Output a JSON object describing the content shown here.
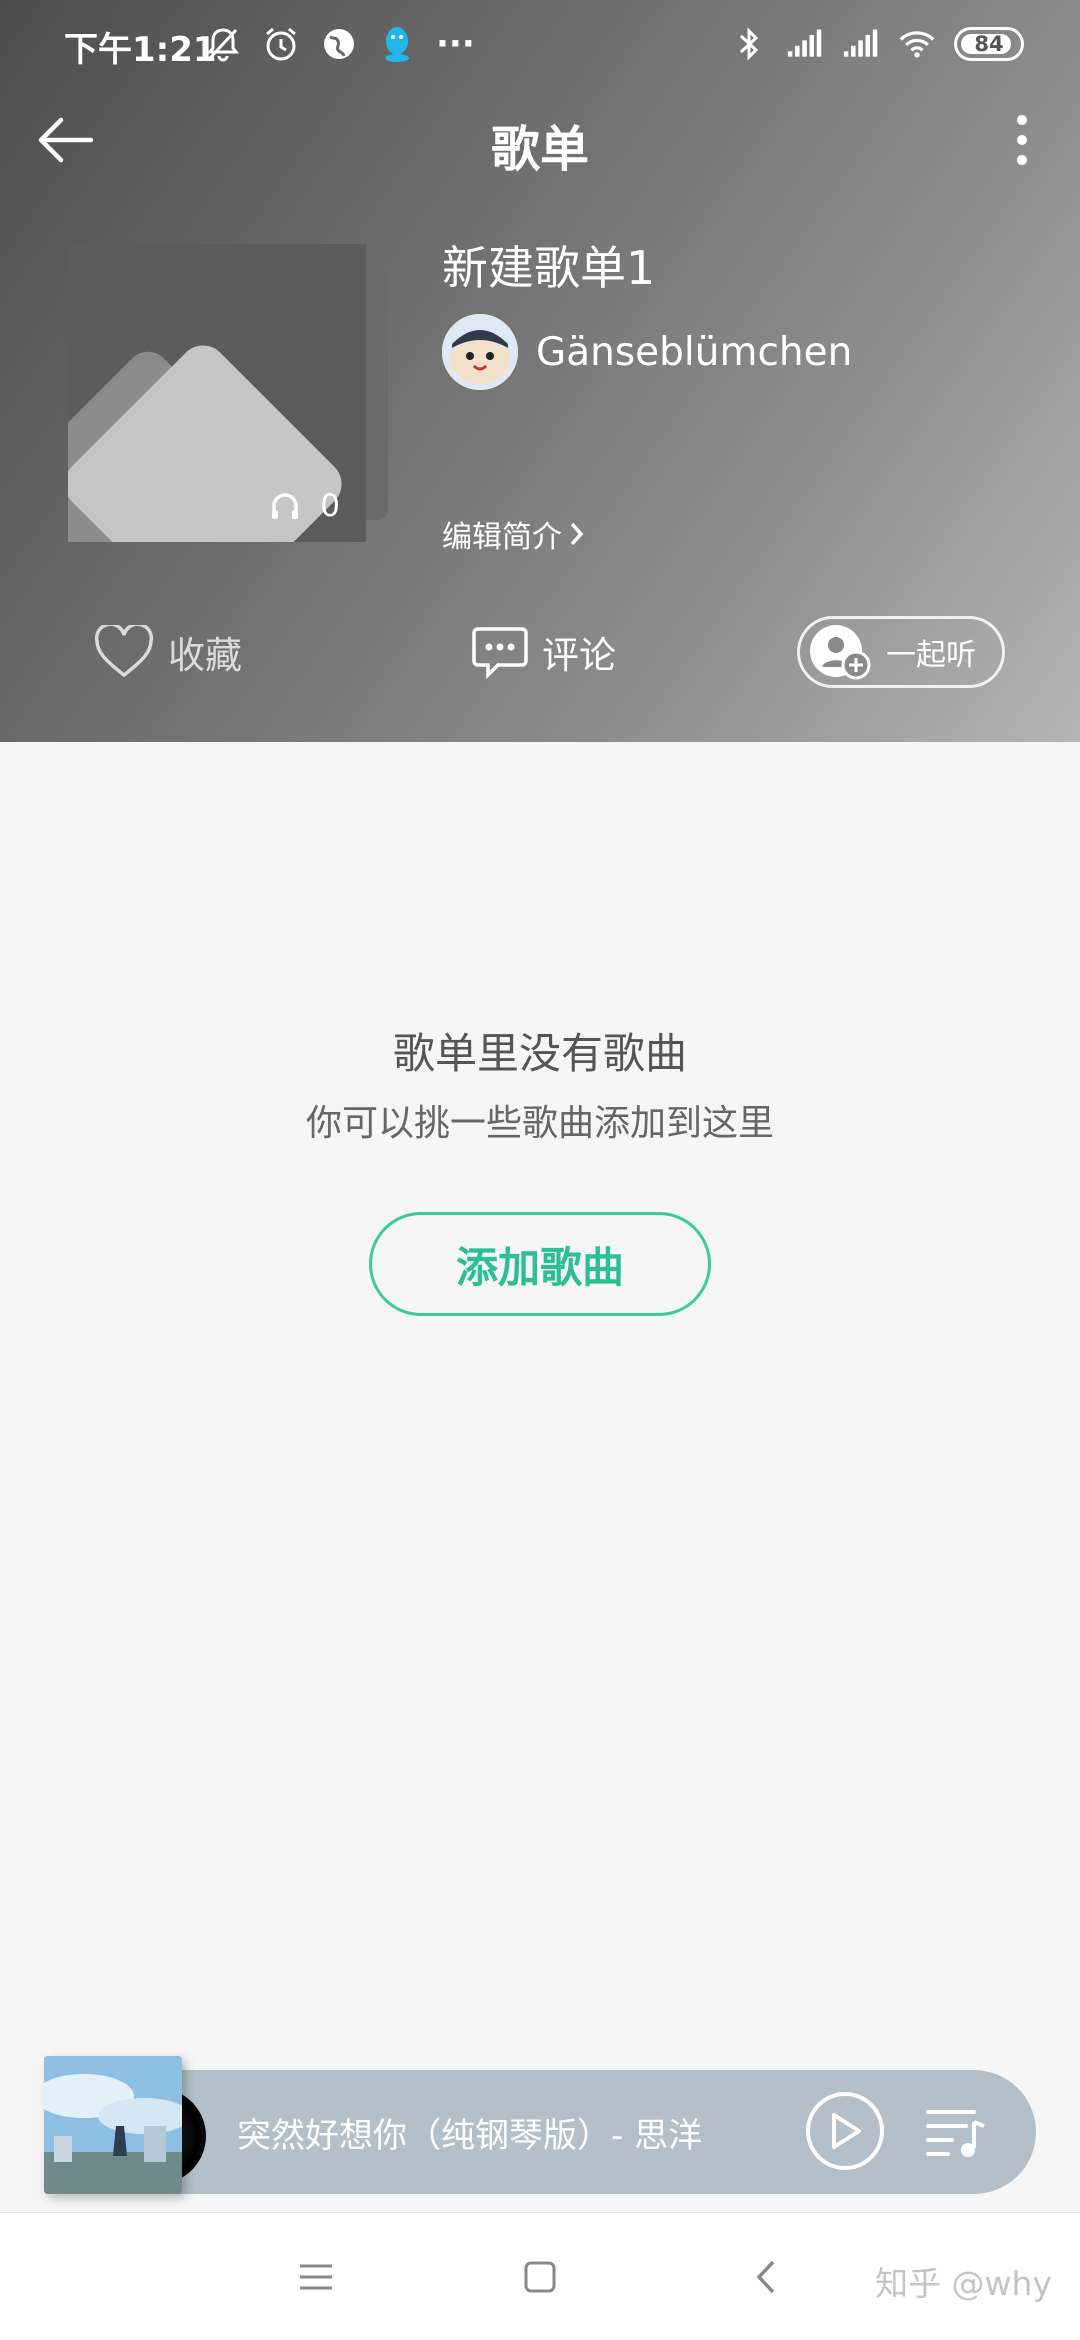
{
  "status_bar": {
    "time": "下午1:21",
    "battery": "84",
    "overflow": "···"
  },
  "nav": {
    "title": "歌单"
  },
  "playlist": {
    "title": "新建歌单1",
    "play_count": "0",
    "creator": "Gänseblümchen",
    "edit_desc": "编辑简介"
  },
  "actions": {
    "favorite": "收藏",
    "comment": "评论",
    "listen_together": "一起听"
  },
  "empty": {
    "title": "歌单里没有歌曲",
    "subtitle": "你可以挑一些歌曲添加到这里",
    "add_button": "添加歌曲"
  },
  "mini_player": {
    "song": "突然好想你（纯钢琴版）- 思洋"
  },
  "watermark": "知乎 @why",
  "colors": {
    "accent": "#2bbf93",
    "mini_bar": "#b4c0c9"
  }
}
